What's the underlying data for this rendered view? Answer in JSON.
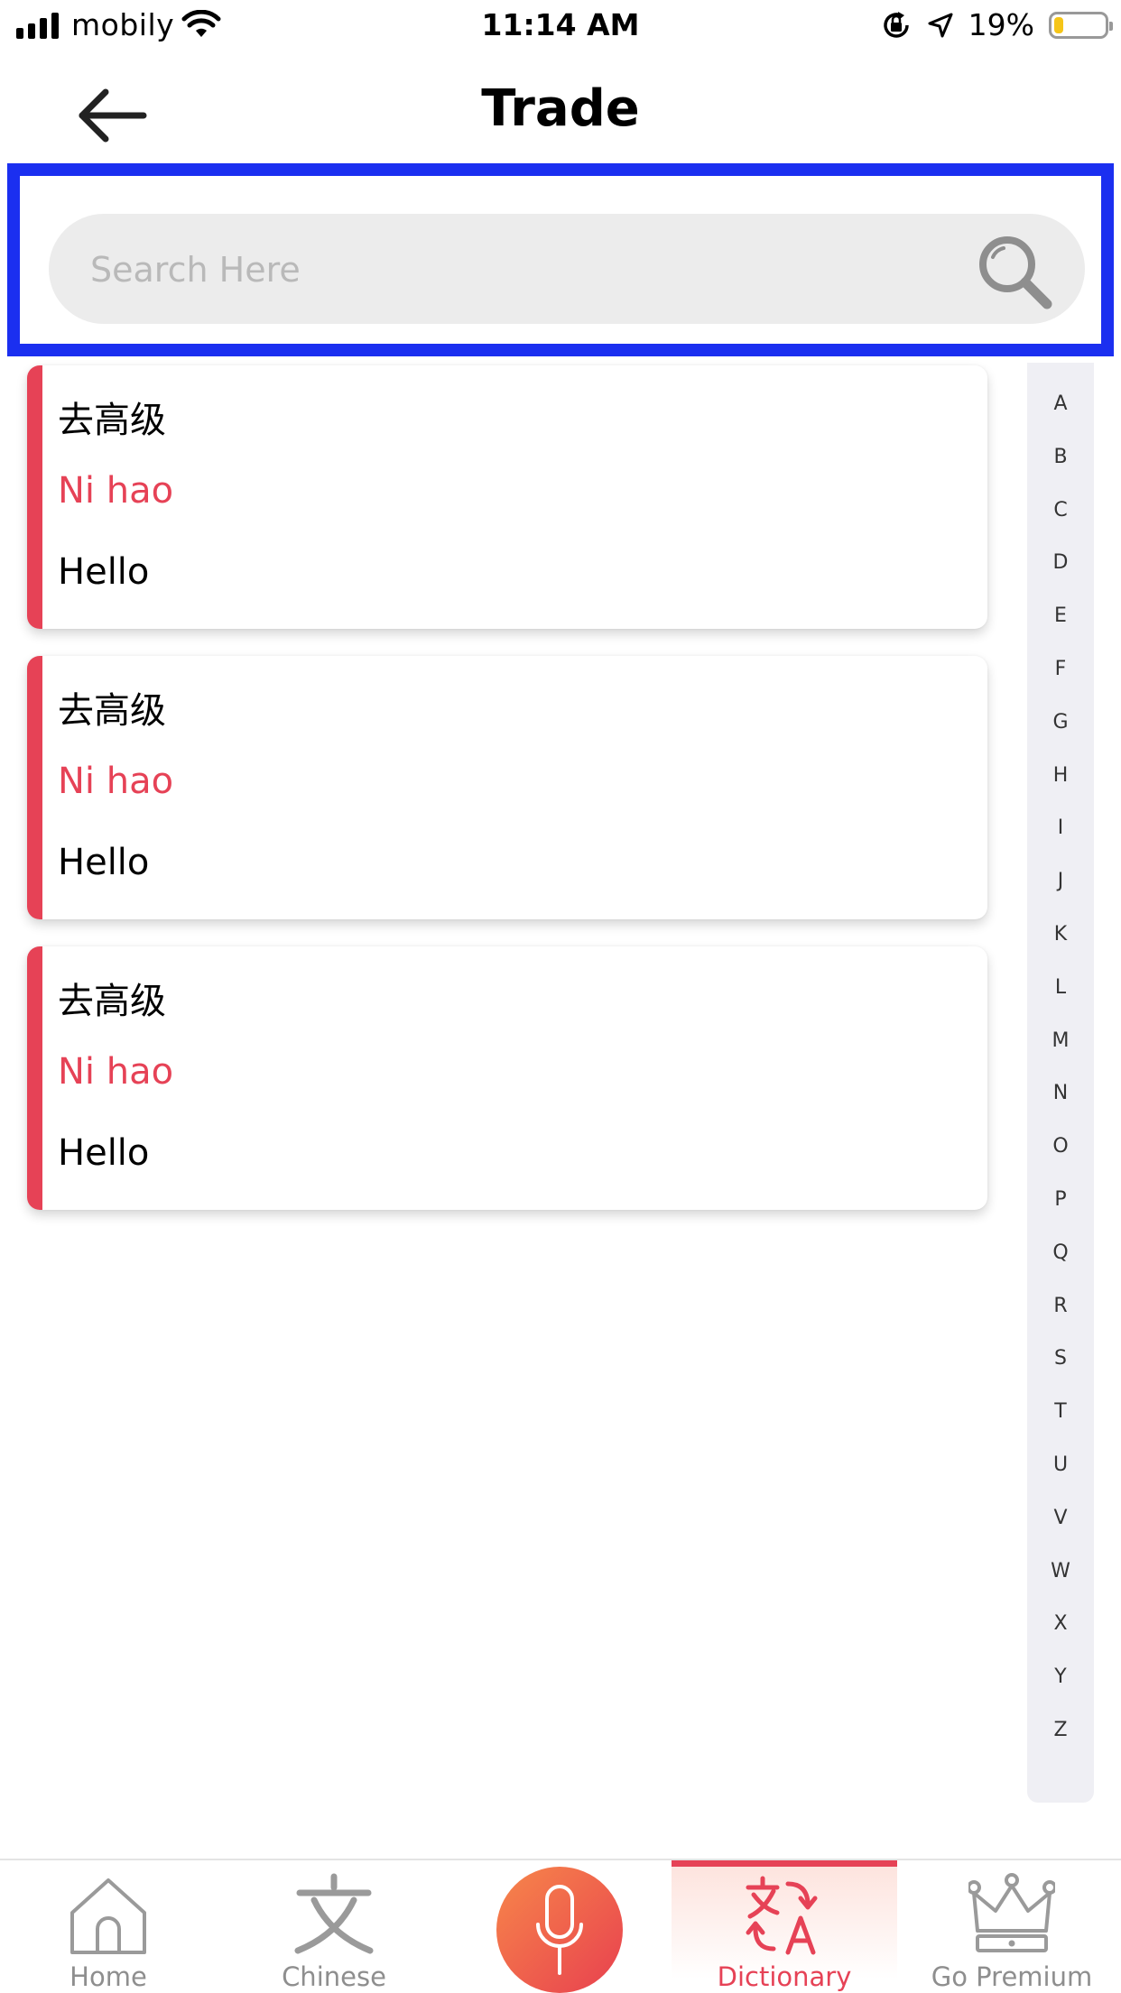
{
  "status_bar": {
    "carrier": "mobily",
    "time": "11:14 AM",
    "battery_percent": "19%",
    "battery_level": 0.19,
    "icons": [
      "signal-icon",
      "wifi-icon",
      "rotation-lock-icon",
      "location-arrow-icon",
      "battery-icon"
    ]
  },
  "nav": {
    "title": "Trade",
    "back_icon": "arrow-left-icon"
  },
  "search": {
    "placeholder": "Search Here",
    "value": "",
    "icon": "magnifier-icon"
  },
  "entries": [
    {
      "chinese": "去高级",
      "pinyin": "Ni hao",
      "english": "Hello"
    },
    {
      "chinese": "去高级",
      "pinyin": "Ni hao",
      "english": "Hello"
    },
    {
      "chinese": "去高级",
      "pinyin": "Ni hao",
      "english": "Hello"
    }
  ],
  "alphabet_index": [
    "A",
    "B",
    "C",
    "D",
    "E",
    "F",
    "G",
    "H",
    "I",
    "J",
    "K",
    "L",
    "M",
    "N",
    "O",
    "P",
    "Q",
    "R",
    "S",
    "T",
    "U",
    "V",
    "W",
    "X",
    "Y",
    "Z"
  ],
  "tabs": [
    {
      "label": "Home",
      "icon": "house-icon",
      "active": false
    },
    {
      "label": "Chinese",
      "icon": "chinese-character-icon",
      "active": false
    },
    {
      "label": "",
      "icon": "microphone-icon",
      "active": false
    },
    {
      "label": "Dictionary",
      "icon": "translate-icon",
      "active": true
    },
    {
      "label": "Go Premium",
      "icon": "crown-icon",
      "active": false
    }
  ],
  "colors": {
    "accent": "#e64256",
    "highlight_border": "#1b2ff0",
    "search_background": "#ececec",
    "index_background": "#efeff4",
    "mic_gradient_start": "#f7874a",
    "mic_gradient_end": "#e8404f"
  }
}
